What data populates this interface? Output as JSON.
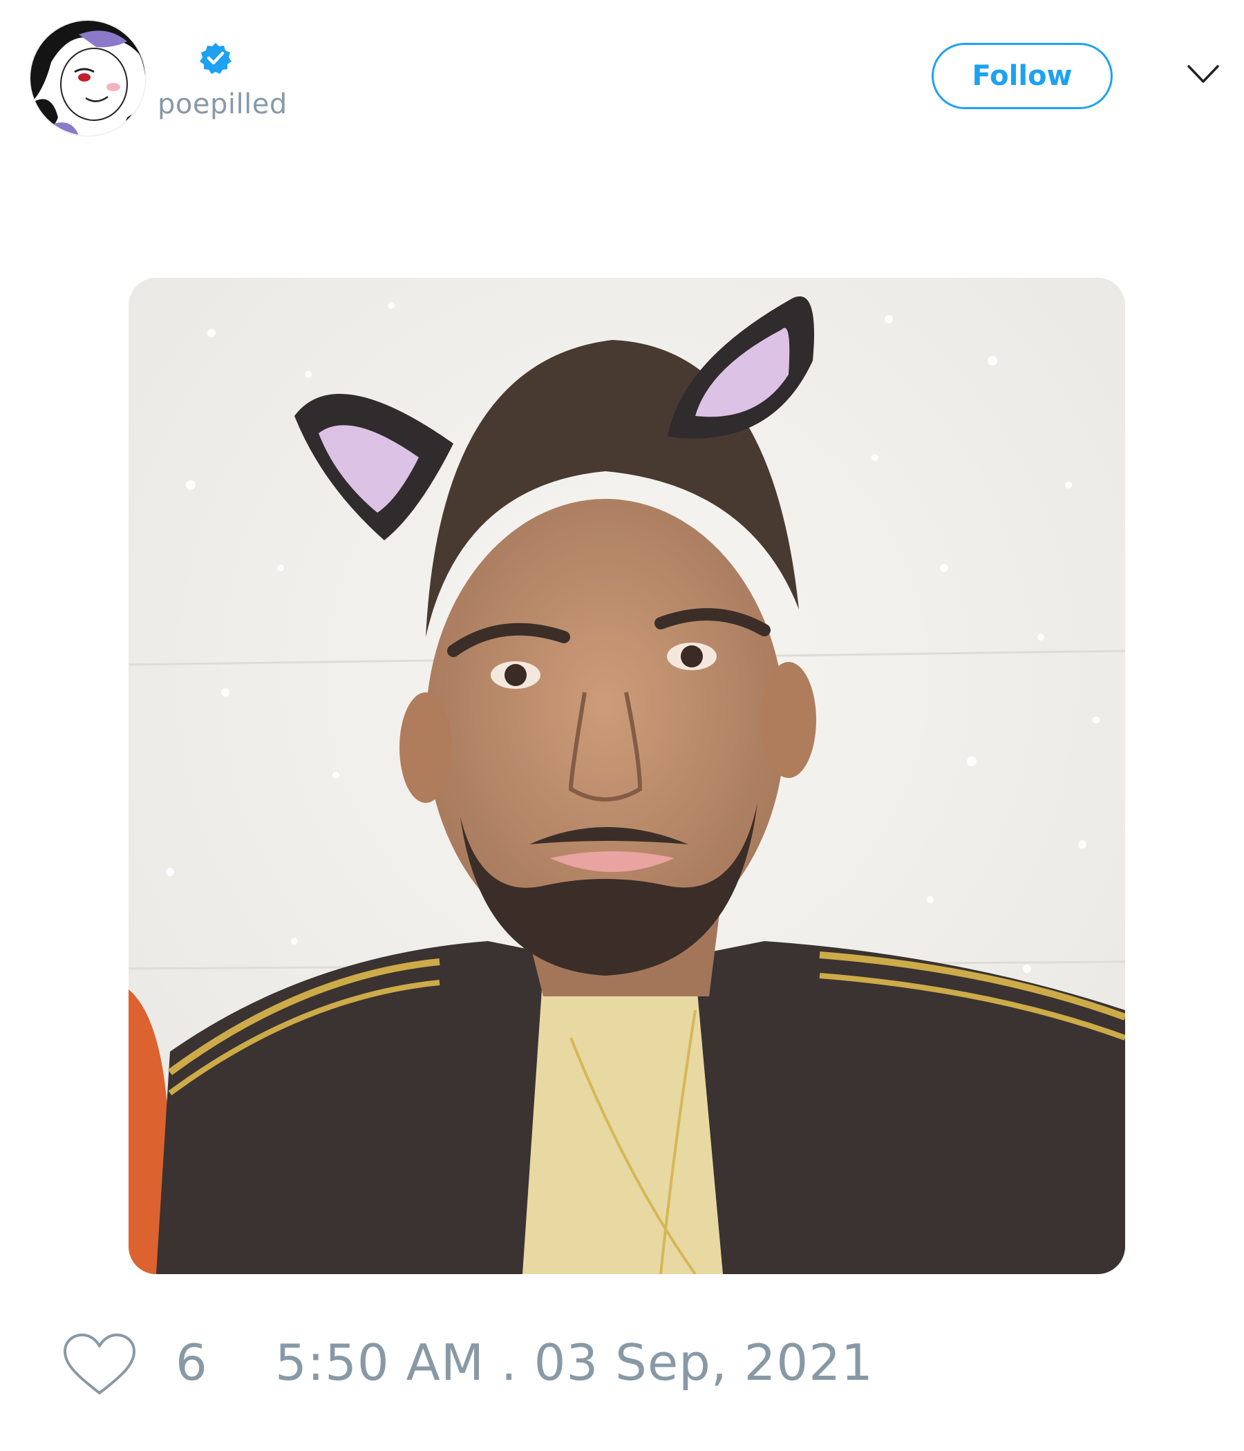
{
  "tweet": {
    "author": {
      "display_name": "",
      "handle": "poepilled",
      "verified": true,
      "avatar_icon": "anime-avatar-icon",
      "badge_icon": "verified-badge-icon"
    },
    "follow_label": "Follow",
    "menu_icon": "chevron-down-icon",
    "media": {
      "icon": "photo-man-with-cat-ears"
    },
    "like_icon": "heart-outline-icon",
    "like_count": "6",
    "timestamp": "5:50 AM . 03 Sep, 2021"
  },
  "colors": {
    "accent": "#1da1f2",
    "muted": "#8899a6",
    "background": "#ffffff"
  }
}
